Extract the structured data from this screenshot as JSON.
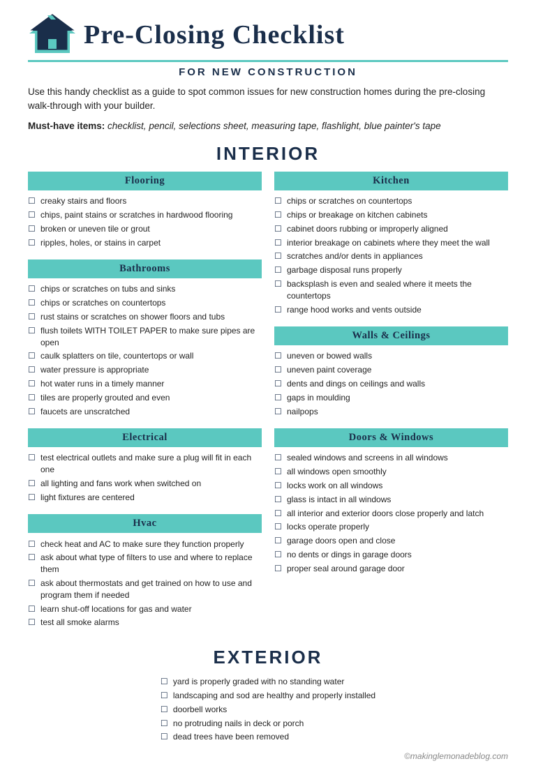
{
  "header": {
    "title": "Pre-Closing Checklist",
    "subtitle": "FOR NEW CONSTRUCTION",
    "intro": "Use this handy checklist as a guide to spot common issues for new construction homes during the pre-closing walk-through with your builder.",
    "must_have_label": "Must-have items:",
    "must_have_items": "checklist, pencil, selections sheet, measuring tape, flashlight, blue painter's tape"
  },
  "interior_label": "INTERIOR",
  "exterior_label": "EXTERIOR",
  "categories": {
    "flooring": {
      "label": "Flooring",
      "items": [
        "creaky stairs and floors",
        "chips, paint stains or scratches in hardwood flooring",
        "broken or uneven tile or grout",
        "ripples, holes, or stains in carpet"
      ]
    },
    "kitchen": {
      "label": "Kitchen",
      "items": [
        "chips or scratches on countertops",
        "chips or breakage on kitchen cabinets",
        "cabinet doors rubbing or improperly aligned",
        "interior breakage on cabinets where they meet the wall",
        "scratches and/or dents in appliances",
        "garbage disposal runs properly",
        "backsplash is even and sealed where it meets the countertops",
        "range hood works and vents outside"
      ]
    },
    "bathrooms": {
      "label": "Bathrooms",
      "items": [
        "chips or scratches on tubs and sinks",
        "chips or scratches on countertops",
        "rust stains or scratches on shower floors and tubs",
        "flush toilets WITH TOILET PAPER to make sure pipes are open",
        "caulk splatters on tile, countertops or wall",
        "water pressure is appropriate",
        "hot water runs in a timely manner",
        "tiles are properly grouted and even",
        "faucets are unscratched"
      ]
    },
    "walls_ceilings": {
      "label": "Walls & Ceilings",
      "items": [
        "uneven or bowed walls",
        "uneven paint coverage",
        "dents and dings on ceilings and walls",
        "gaps in moulding",
        "nailpops"
      ]
    },
    "electrical": {
      "label": "Electrical",
      "items": [
        "test electrical outlets and make sure a plug will fit in each one",
        "all lighting and fans work when switched on",
        "light fixtures are centered"
      ]
    },
    "doors_windows": {
      "label": "Doors & Windows",
      "items": [
        "sealed windows and screens in all windows",
        "all windows open smoothly",
        "locks work on all windows",
        "glass is intact in all windows",
        "all interior and exterior doors close properly and latch",
        "locks operate properly",
        "garage doors open and close",
        "no dents or dings in garage doors",
        "proper seal around garage door"
      ]
    },
    "hvac": {
      "label": "Hvac",
      "items": [
        "check heat and AC to make sure they function properly",
        "ask about what type of filters to use and where to replace them",
        "ask about thermostats and get trained on how to use and program them if needed",
        "learn shut-off locations for gas and water",
        "test all smoke alarms"
      ]
    },
    "exterior": {
      "label": "Exterior",
      "items": [
        "yard is properly graded with no standing water",
        "landscaping and sod are healthy and properly installed",
        "doorbell works",
        "no protruding nails in deck or porch",
        "dead trees have been removed"
      ]
    }
  },
  "footer": "©makinglemonadeblog.com"
}
